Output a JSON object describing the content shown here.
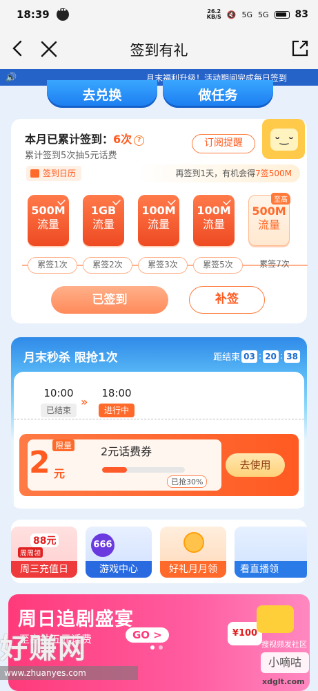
{
  "status_bar": {
    "time": "18:39",
    "speed_top": "26.2",
    "speed_unit": "KB/S",
    "signal1": "5G",
    "signal2": "5G",
    "battery": "83"
  },
  "nav": {
    "title": "签到有礼",
    "icons": {
      "back": "chevron-left-icon",
      "close": "close-icon",
      "share": "share-icon"
    }
  },
  "marquee": {
    "text": "月末福利升级！活动期间完成每日签到"
  },
  "top_buttons": {
    "exchange": "去兑换",
    "tasks": "做任务"
  },
  "checkin": {
    "title_prefix": "本月已累计签到：",
    "count": "6次",
    "help": "?",
    "subtitle": "累计签到5次抽5元话费",
    "subscribe_label": "订阅提醒",
    "calendar_label": "签到日历",
    "tip_prefix": "再签到1天，有机会得",
    "tip_highlight": "7签500M",
    "rewards": [
      {
        "amount": "500M",
        "unit": "流量"
      },
      {
        "amount": "1GB",
        "unit": "流量"
      },
      {
        "amount": "100M",
        "unit": "流量"
      },
      {
        "amount": "100M",
        "unit": "流量"
      },
      {
        "amount": "500M",
        "unit": "流量",
        "tag": "至高"
      }
    ],
    "days": [
      "累签1次",
      "累签2次",
      "累签3次",
      "累签5次",
      "累签7次"
    ],
    "done_label": "已签到",
    "makeup_label": "补签"
  },
  "flash_sale": {
    "title": "月末秒杀 限抢1次",
    "countdown_label": "距结束",
    "countdown": [
      "03",
      "20",
      "38"
    ],
    "slots": [
      {
        "time": "10:00",
        "status": "已结束"
      },
      {
        "time": "18:00",
        "status": "进行中"
      }
    ],
    "coupon": {
      "limit_tag": "限量",
      "value": "2",
      "unit": "元",
      "name": "2元话费券",
      "progress": 0.3,
      "progress_label": "已抢30%",
      "use_label": "去使用"
    }
  },
  "tiles": [
    {
      "label": "周三充值日",
      "badge": "88元",
      "sub": "周周领"
    },
    {
      "label": "游戏中心",
      "badge": "666"
    },
    {
      "label": "好礼月月领"
    },
    {
      "label": "看直播领"
    }
  ],
  "banner": {
    "title": "周日追剧盛宴",
    "subtitle": "至高抽五元话费",
    "go": "GO >",
    "gift": "¥100",
    "tag": "搜视频发社区"
  },
  "watermark": {
    "brand": "好赚网",
    "url": "www.zhuanyes.com",
    "extra": "小嘀咕",
    "domain2": "xdglt.com"
  }
}
